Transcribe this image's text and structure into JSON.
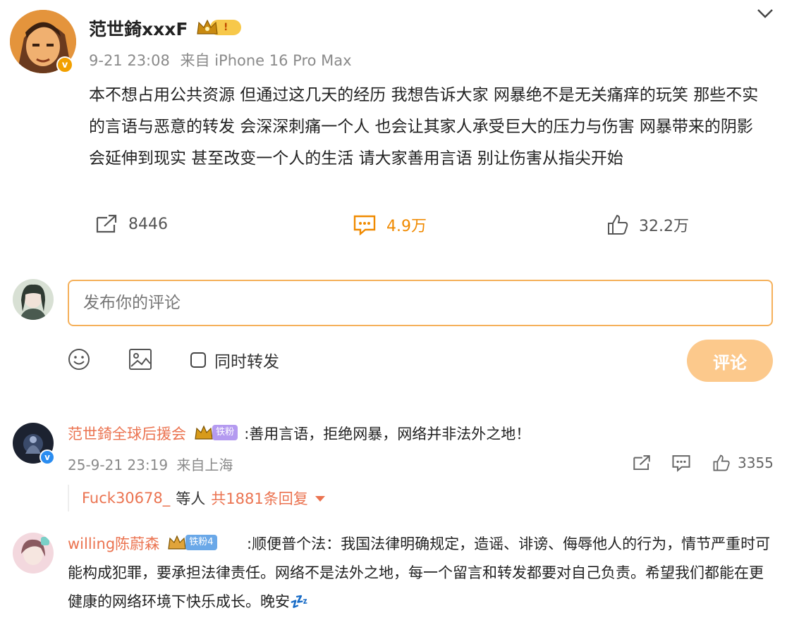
{
  "post": {
    "author": "范世錡xxxF",
    "crown_badge": "!",
    "timestamp": "9-21 23:08",
    "source": "来自 iPhone 16 Pro Max",
    "text": "本不想占用公共资源 但通过这几天的经历 我想告诉大家 网暴绝不是无关痛痒的玩笑 那些不实的言语与恶意的转发 会深深刺痛一个人 也会让其家人承受巨大的压力与伤害 网暴带来的阴影会延伸到现实 甚至改变一个人的生活 请大家善用言语 别让伤害从指尖开始",
    "verified_badge": "v",
    "reposts": "8446",
    "comments": "4.9万",
    "likes": "32.2万"
  },
  "composer": {
    "placeholder": "发布你的评论",
    "repost_label": "同时转发",
    "submit_label": "评论"
  },
  "comments": [
    {
      "user": "范世錡全球后援会",
      "badge": "铁粉",
      "text": ":善用言语，拒绝网暴，网络并非法外之地！",
      "time": "25-9-21 23:19",
      "location": "来自上海",
      "likes": "3355",
      "verified_badge": "v",
      "replies": {
        "user": "Fuck30678_",
        "middle": "等人",
        "total": "共1881条回复"
      }
    },
    {
      "user": "willing陈蔚森",
      "badge": "铁粉4",
      "text": ":顺便普个法：我国法律明确规定，造谣、诽谤、侮辱他人的行为，情节严重时可能构成犯罪，要承担法律责任。网络不是法外之地，每一个留言和转发都要对自己负责。希望我们都能在更健康的网络环境下快乐成长。晚安💤"
    }
  ],
  "colors": {
    "accent": "#f08a00",
    "username": "#eb7350",
    "button": "#fcc98c",
    "input_border": "#f5b05a"
  }
}
